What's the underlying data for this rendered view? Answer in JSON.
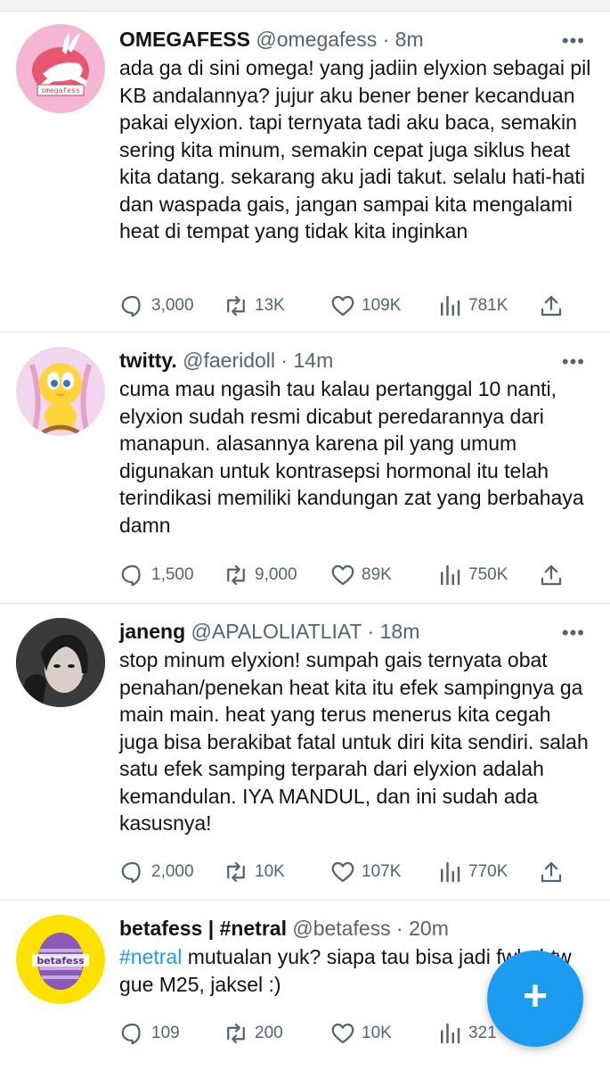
{
  "tweets": [
    {
      "name": "OMEGAFESS",
      "handle": "@omegafess",
      "time": "8m",
      "text": "ada ga di sini omega! yang jadiin elyxion sebagai pil KB andalannya? jujur aku bener bener kecanduan pakai elyxion. tapi ternyata tadi aku baca, semakin sering kita minum, semakin cepat juga siklus heat kita datang. sekarang aku jadi takut. selalu hati-hati dan waspada gais, jangan sampai kita mengalami heat di tempat yang tidak kita inginkan",
      "replies": "3,000",
      "retweets": "13K",
      "likes": "109K",
      "views": "781K",
      "avatar_text": "omegafess"
    },
    {
      "name": "twitty.",
      "handle": "@faeridoll",
      "time": "14m",
      "text": "cuma mau ngasih tau kalau pertanggal 10 nanti, elyxion sudah resmi dicabut peredarannya dari manapun. alasannya karena pil yang umum digunakan untuk kontrasepsi hormonal itu telah terindikasi memiliki kandungan zat yang berbahaya damn",
      "replies": "1,500",
      "retweets": "9,000",
      "likes": "89K",
      "views": "750K"
    },
    {
      "name": "janeng",
      "handle": "@APALOLIATLIAT",
      "time": "18m",
      "text": "stop minum elyxion! sumpah gais ternyata obat penahan/penekan heat kita itu efek sampingnya ga main main. heat yang terus menerus kita cegah juga bisa berakibat fatal untuk diri kita sendiri. salah satu efek samping terparah dari elyxion adalah kemandulan. IYA MANDUL, dan ini sudah ada kasusnya!",
      "replies": "2,000",
      "retweets": "10K",
      "likes": "107K",
      "views": "770K"
    },
    {
      "name": "betafess | #netral",
      "handle": "@betafess",
      "time": "20m",
      "hashtag": "#netral",
      "text": "mutualan yuk? siapa tau bisa jadi fwb. btw gue M25, jaksel :)",
      "replies": "109",
      "retweets": "200",
      "likes": "10K",
      "views": "321",
      "avatar_text": "betafess"
    }
  ],
  "separator": "·",
  "more_glyph": "•••",
  "compose_glyph": "+",
  "colors": {
    "accent": "#1d9bf0",
    "muted": "#536471",
    "text": "#0f1419",
    "divider": "#e1e8ed",
    "omega_bg": "#f4b6d4",
    "beta_bg": "#ffe100",
    "beta_egg": "#8a5bb6"
  }
}
